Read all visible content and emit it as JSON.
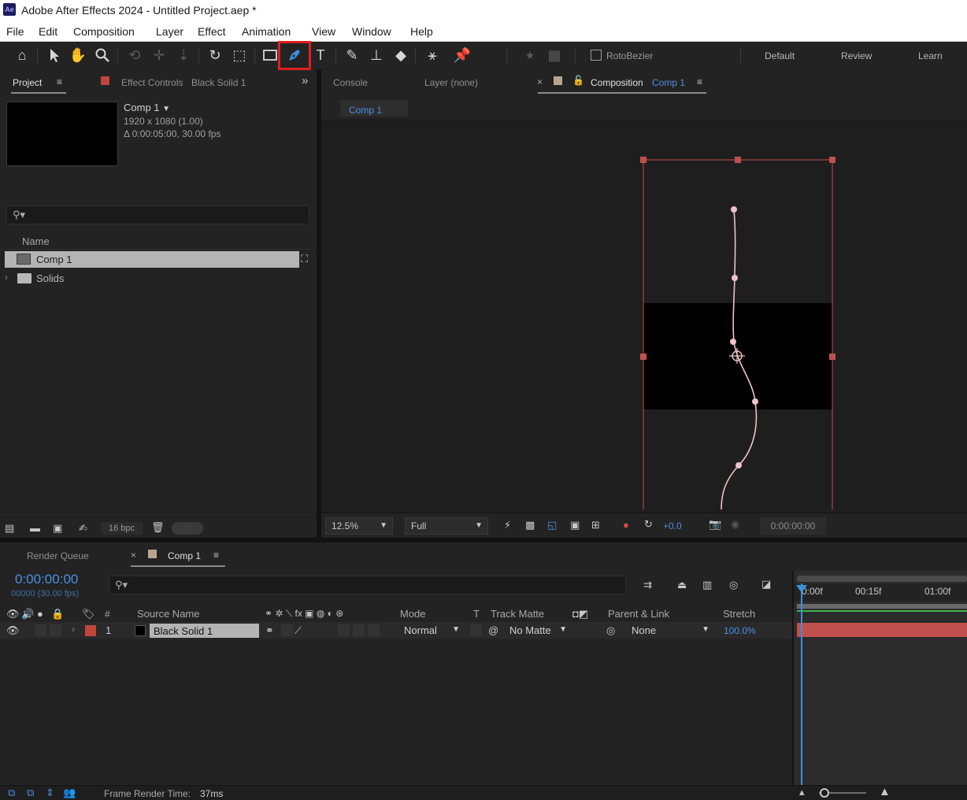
{
  "window": {
    "app_icon": "Ae",
    "title": "Adobe After Effects 2024 - Untitled Project.aep *"
  },
  "menu": [
    "File",
    "Edit",
    "Composition",
    "Layer",
    "Effect",
    "Animation",
    "View",
    "Window",
    "Help"
  ],
  "toolbar": {
    "tools": [
      "home-icon",
      "selection-icon",
      "hand-icon",
      "zoom-icon",
      "orbit-camera-icon",
      "pan-camera-icon",
      "dolly-camera-icon",
      "rotation-icon",
      "pan-behind-icon",
      "rectangle-icon",
      "pen-icon",
      "type-icon",
      "brush-icon",
      "clone-stamp-icon",
      "eraser-icon",
      "roto-brush-icon",
      "puppet-pin-icon"
    ],
    "selected_tool": "pen-icon",
    "rotobezier_label": "RotoBezier",
    "workspaces": [
      "Default",
      "Review",
      "Learn"
    ]
  },
  "project_panel": {
    "tab_label": "Project",
    "effect_controls_label": "Effect Controls",
    "effect_controls_layer": "Black Solid 1",
    "comp_name": "Comp 1",
    "comp_dims": "1920 x 1080 (1.00)",
    "comp_duration": "Δ 0:00:05:00, 30.00 fps",
    "search_placeholder": "",
    "name_header": "Name",
    "items": [
      {
        "name": "Comp 1",
        "type": "composition",
        "selected": true
      },
      {
        "name": "Solids",
        "type": "folder",
        "selected": false
      }
    ],
    "bpc_label": "16 bpc"
  },
  "viewer": {
    "tabs": [
      "Console",
      "Layer (none)"
    ],
    "comp_tab_prefix": "Composition",
    "comp_tab_name": "Comp 1",
    "breadcrumb": "Comp 1",
    "zoom": "12.5%",
    "resolution": "Full",
    "exposure": "+0.0",
    "timecode": "0:00:00:00"
  },
  "timeline": {
    "render_queue_label": "Render Queue",
    "comp_tab": "Comp 1",
    "current_time": "0:00:00:00",
    "frame_info": "00000 (30.00 fps)",
    "columns": {
      "num": "#",
      "source_name": "Source Name",
      "mode": "Mode",
      "t": "T",
      "track_matte": "Track Matte",
      "parent_link": "Parent & Link",
      "stretch": "Stretch"
    },
    "layers": [
      {
        "index": "1",
        "name": "Black Solid 1",
        "mode": "Normal",
        "matte": "No Matte",
        "parent": "None",
        "stretch": "100.0%",
        "label_color": "#c0453a"
      }
    ],
    "ruler": [
      "0:00f",
      "00:15f",
      "01:00f"
    ],
    "frame_render_label": "Frame Render Time:",
    "frame_render_value": "37ms"
  },
  "colors": {
    "accent_blue": "#4a90e2",
    "layer_bar": "#c0504d",
    "highlight_box": "#e01e1e",
    "path_handle": "#f0c0c8",
    "bbox": "#c0504d"
  }
}
